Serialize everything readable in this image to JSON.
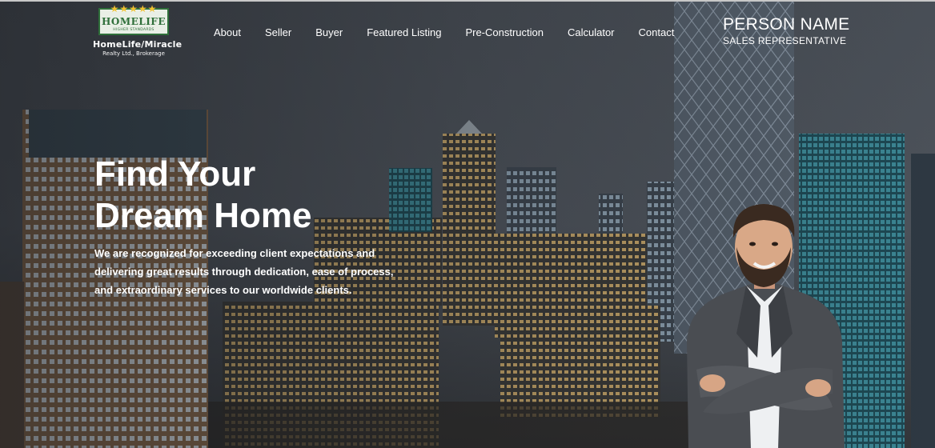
{
  "logo": {
    "stars": "★★★★★",
    "wordmark": "HOMELIFE",
    "tagline": "HIGHER STANDARDS",
    "company": "HomeLife/Miracle",
    "subtitle": "Realty Ltd., Brokerage"
  },
  "nav": {
    "items": [
      "About",
      "Seller",
      "Buyer",
      "Featured Listing",
      "Pre-Construction",
      "Calculator",
      "Contact"
    ]
  },
  "agent": {
    "name": "PERSON NAME",
    "title": "SALES REPRESENTATIVE"
  },
  "hero": {
    "headline_line1": "Find Your",
    "headline_line2": "Dream Home",
    "sub_line1": "We are recognized for exceeding client expectations and",
    "sub_line2": "delivering great results through dedication, ease of process,",
    "sub_line3": "and extraordinary services to our worldwide clients."
  },
  "colors": {
    "brand_green": "#2f6f3a",
    "star_gold": "#f2c230",
    "text": "#ffffff"
  }
}
